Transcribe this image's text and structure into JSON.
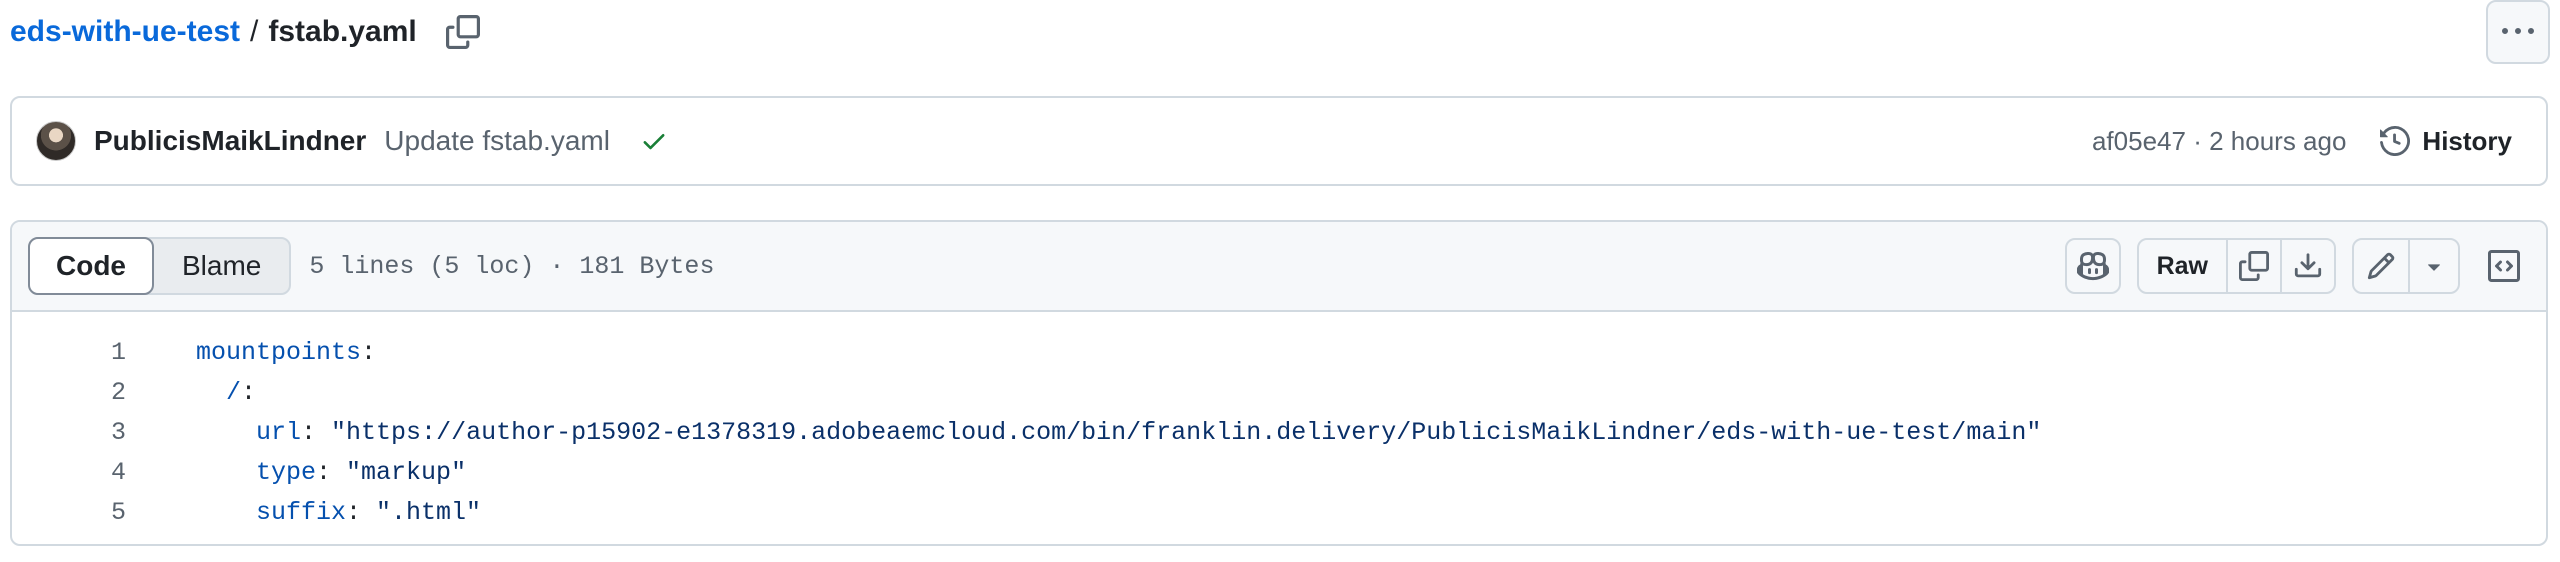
{
  "breadcrumb": {
    "repo": "eds-with-ue-test",
    "separator": "/",
    "file": "fstab.yaml"
  },
  "commit": {
    "author": "PublicisMaikLindner",
    "message": "Update fstab.yaml",
    "status": "success",
    "sha": "af05e47",
    "dot": "·",
    "time": "2 hours ago",
    "history_label": "History"
  },
  "file_toolbar": {
    "tabs": [
      {
        "label": "Code",
        "active": true
      },
      {
        "label": "Blame",
        "active": false
      }
    ],
    "meta": "5 lines (5 loc) · 181 Bytes",
    "raw_label": "Raw"
  },
  "code_lines": [
    {
      "n": "1",
      "indent": "",
      "key": "mountpoints",
      "sep": ":",
      "value": ""
    },
    {
      "n": "2",
      "indent": "  ",
      "key": "/",
      "sep": ":",
      "value": ""
    },
    {
      "n": "3",
      "indent": "    ",
      "key": "url",
      "sep": ": ",
      "value": "\"https://author-p15902-e1378319.adobeaemcloud.com/bin/franklin.delivery/PublicisMaikLindner/eds-with-ue-test/main\""
    },
    {
      "n": "4",
      "indent": "    ",
      "key": "type",
      "sep": ": ",
      "value": "\"markup\""
    },
    {
      "n": "5",
      "indent": "    ",
      "key": "suffix",
      "sep": ": ",
      "value": "\".html\""
    }
  ],
  "icons": {
    "copy_path": "copy-icon",
    "more": "kebab-horizontal-icon",
    "check": "check-icon",
    "history": "history-icon",
    "copilot": "copilot-icon",
    "copy_raw": "copy-icon",
    "download": "download-icon",
    "edit": "pencil-icon",
    "caret": "triangle-down-icon",
    "symbols": "code-square-icon"
  },
  "colors": {
    "link": "#0969da",
    "success": "#1a7f37",
    "muted": "#59636e",
    "border": "#d1d9e0",
    "yaml_key": "#0550ae",
    "yaml_string": "#0a3069"
  }
}
